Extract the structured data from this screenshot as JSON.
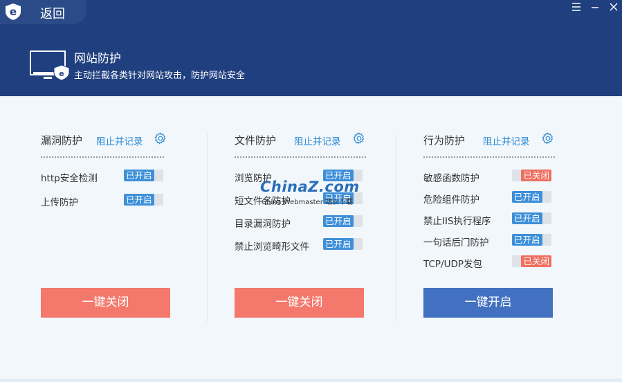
{
  "topbar": {
    "back_label": "返回",
    "menu_icon": "menu-icon",
    "minimize_icon": "minimize-icon",
    "close_icon": "close-icon"
  },
  "header": {
    "title": "网站防护",
    "subtitle": "主动拦截各类针对网站攻击，防护网站安全"
  },
  "columns": [
    {
      "title": "漏洞防护",
      "mode": "阻止并记录",
      "items": [
        {
          "label": "http安全检测",
          "status": "已开启",
          "on": true
        },
        {
          "label": "上传防护",
          "status": "已开启",
          "on": true
        }
      ],
      "button": "一键关闭"
    },
    {
      "title": "文件防护",
      "mode": "阻止并记录",
      "items": [
        {
          "label": "浏览防护",
          "status": "已开启",
          "on": true
        },
        {
          "label": "短文件名防护",
          "status": "已开启",
          "on": true
        },
        {
          "label": "目录漏洞防护",
          "status": "已开启",
          "on": true
        },
        {
          "label": "禁止浏览畸形文件",
          "status": "已开启",
          "on": true
        }
      ],
      "button": "一键关闭"
    },
    {
      "title": "行为防护",
      "mode": "阻止并记录",
      "items": [
        {
          "label": "敏感函数防护",
          "status": "已关闭",
          "on": false
        },
        {
          "label": "危险组件防护",
          "status": "已开启",
          "on": true
        },
        {
          "label": "禁止IIS执行程序",
          "status": "已开启",
          "on": true
        },
        {
          "label": "一句话后门防护",
          "status": "已开启",
          "on": true
        },
        {
          "label": "TCP/UDP发包",
          "status": "已关闭",
          "on": false
        }
      ],
      "button": "一键开启"
    }
  ],
  "watermark": {
    "main": "ChinaZ.com",
    "sub": "China Webmaster  站长下载"
  },
  "colors": {
    "header_bg": "#1f3f7f",
    "link": "#2b8ad6",
    "on": "#3d8fd9",
    "off": "#ef6e5e",
    "btn_close": "#f4786b",
    "btn_open": "#4271c2"
  }
}
